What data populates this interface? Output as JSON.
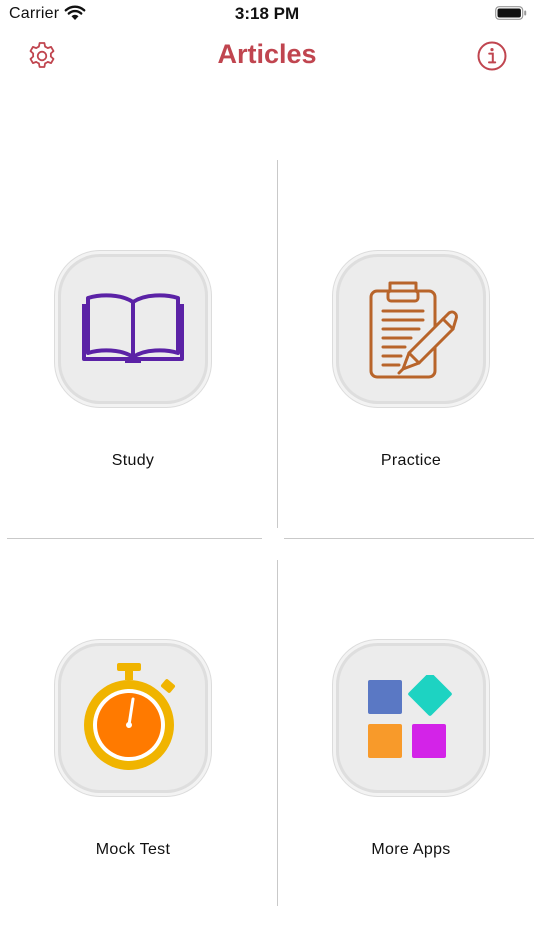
{
  "status_bar": {
    "carrier": "Carrier",
    "time": "3:18 PM"
  },
  "nav": {
    "title": "Articles",
    "left_icon": "gear-icon",
    "right_icon": "info-icon"
  },
  "accent_color": "#c0454f",
  "tiles": [
    {
      "label": "Study",
      "icon": "book-icon",
      "color": "#5b22a6"
    },
    {
      "label": "Practice",
      "icon": "clipboard-pen-icon",
      "color": "#b8642a"
    },
    {
      "label": "Mock Test",
      "icon": "stopwatch-icon",
      "colors": [
        "#f0b400",
        "#ff7a00"
      ]
    },
    {
      "label": "More Apps",
      "icon": "app-grid-icon",
      "colors": [
        "#5a78c4",
        "#1dd3c2",
        "#f89a2a",
        "#d323e8"
      ]
    }
  ]
}
